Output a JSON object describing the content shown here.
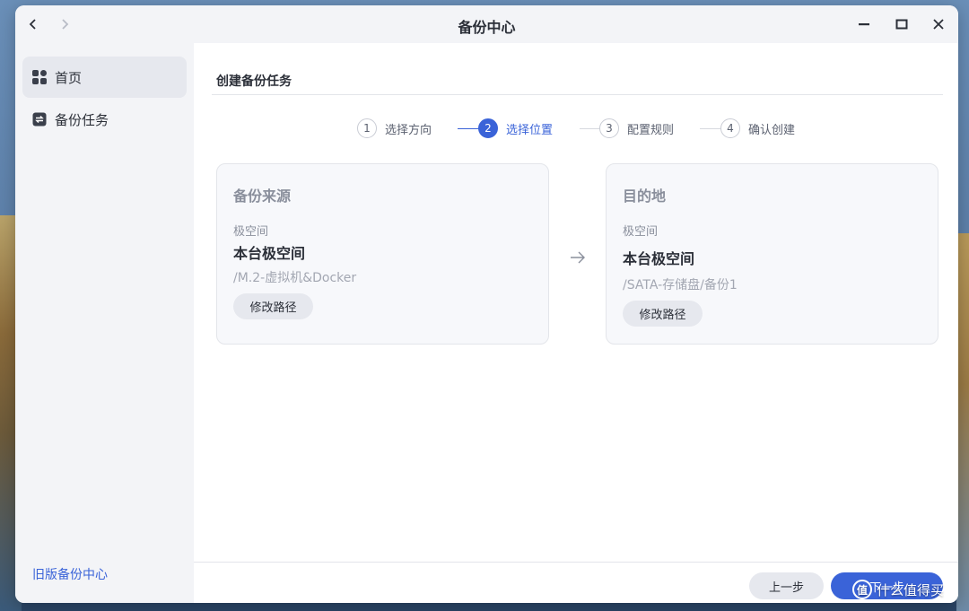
{
  "window": {
    "title": "备份中心"
  },
  "sidebar": {
    "items": [
      {
        "label": "首页",
        "icon": "grid-icon",
        "active": true
      },
      {
        "label": "备份任务",
        "icon": "sync-icon",
        "active": false
      }
    ],
    "legacy_link": "旧版备份中心"
  },
  "main": {
    "heading": "创建备份任务",
    "steps": [
      {
        "num": "1",
        "label": "选择方向",
        "state": "done"
      },
      {
        "num": "2",
        "label": "选择位置",
        "state": "active"
      },
      {
        "num": "3",
        "label": "配置规则",
        "state": "pending"
      },
      {
        "num": "4",
        "label": "确认创建",
        "state": "pending"
      }
    ],
    "source": {
      "title": "备份来源",
      "subtitle": "极空间",
      "name": "本台极空间",
      "path": "/M.2-虚拟机&Docker",
      "button": "修改路径"
    },
    "destination": {
      "title": "目的地",
      "subtitle": "极空间",
      "name": "本台极空间",
      "path": "/SATA-存储盘/备份1",
      "button": "修改路径"
    }
  },
  "footer": {
    "prev_label": "上一步",
    "next_label": "下一步"
  },
  "watermark": {
    "badge": "值",
    "text": "什么值得买"
  },
  "colors": {
    "accent": "#3a63d8",
    "sidebar_bg": "#f3f4f7",
    "card_bg": "#f7f8fb"
  }
}
